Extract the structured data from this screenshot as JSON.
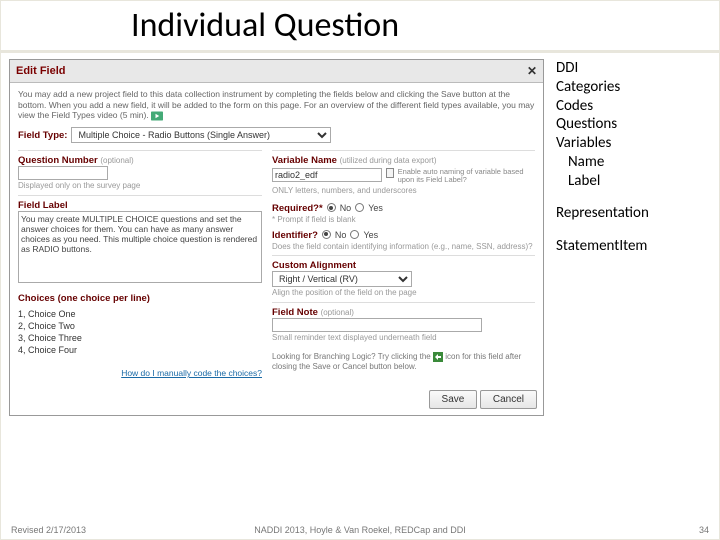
{
  "title": "Individual Question",
  "sidebar": {
    "lines": [
      "DDI",
      "Categories",
      "Codes",
      "Questions",
      "Variables"
    ],
    "indented": [
      "Name",
      "Label"
    ],
    "rep": "Representation",
    "stmt": "StatementItem"
  },
  "dialog": {
    "header": "Edit Field",
    "intro": "You may add a new project field to this data collection instrument by completing the fields below and clicking the Save button at the bottom. When you add a new field, it will be added to the form on this page. For an overview of the different field types available, you may view the       Field Types video (5 min).",
    "fieldTypeLabel": "Field Type:",
    "fieldTypeValue": "Multiple Choice - Radio Buttons (Single Answer)",
    "qnum": {
      "label": "Question Number",
      "optional": "(optional)",
      "hint": "Displayed only on the survey page"
    },
    "flabel": {
      "label": "Field Label",
      "text": "You may create MULTIPLE CHOICE questions and set the answer choices for them. You can have as many answer choices as you need. This multiple choice question is rendered as RADIO buttons.",
      "link": "How do I manually code the choices?"
    },
    "choices": {
      "label": "Choices (one choice per line)",
      "items": [
        "1, Choice One",
        "2, Choice Two",
        "3, Choice Three",
        "4, Choice Four"
      ]
    },
    "varname": {
      "label": "Variable Name",
      "hint": "(utilized during data export)",
      "value": "radio2_edf",
      "hint2": "ONLY letters, numbers, and underscores",
      "auto": "Enable auto naming of variable based upon its Field Label?"
    },
    "required": {
      "label": "Required?*",
      "no": "No",
      "yes": "Yes",
      "hint": "* Prompt if field is blank"
    },
    "identifier": {
      "label": "Identifier?",
      "no": "No",
      "yes": "Yes",
      "hint": "Does the field contain identifying information (e.g., name, SSN, address)?"
    },
    "align": {
      "label": "Custom Alignment",
      "value": "Right / Vertical (RV)",
      "hint": "Align the position of the field on the page"
    },
    "note": {
      "label": "Field Note",
      "optional": "(optional)",
      "hint": "Small reminder text displayed underneath field"
    },
    "branch": {
      "pre": "Looking for Branching Logic? Try clicking the ",
      "post": " icon for this field after closing the Save or Cancel button below."
    },
    "buttons": {
      "save": "Save",
      "cancel": "Cancel"
    }
  },
  "footer": {
    "left": "Revised 2/17/2013",
    "center": "NADDI 2013, Hoyle & Van Roekel, REDCap and DDI",
    "page": "34"
  }
}
